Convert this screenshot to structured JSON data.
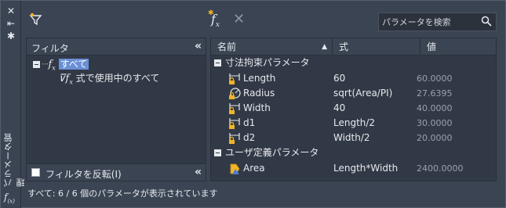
{
  "palette": {
    "vertical_title": "パラメータ管理",
    "side_fx": "f",
    "side_fx_sub": "(x)"
  },
  "toolbar": {
    "search_placeholder": "パラメータを検索",
    "fx_label": "f",
    "fx_sub": "x",
    "delete_label": "✕"
  },
  "filter": {
    "header": "フィルタ",
    "collapse": "«",
    "tree": {
      "root_fx": "f",
      "root_sub": "x",
      "root_label": "すべて",
      "child_fx": "f",
      "child_sub": "x",
      "child_label": "式で使用中のすべて"
    },
    "invert_label": "フィルタを反転(I)",
    "footer_collapse": "«"
  },
  "grid": {
    "columns": {
      "name": "名前",
      "expr": "式",
      "value": "値"
    },
    "sort_indicator": "▲",
    "groups": [
      {
        "label": "寸法拘束パラメータ",
        "rows": [
          {
            "icon": "linear-dimension-icon",
            "name": "Length",
            "expr": "60",
            "value": "60.0000"
          },
          {
            "icon": "radius-dimension-icon",
            "name": "Radius",
            "expr": "sqrt(Area/PI)",
            "value": "27.6395"
          },
          {
            "icon": "linear-dimension-icon",
            "name": "Width",
            "expr": "40",
            "value": "40.0000"
          },
          {
            "icon": "linear-dimension-icon",
            "name": "d1",
            "expr": "Length/2",
            "value": "30.0000"
          },
          {
            "icon": "linear-dimension-icon",
            "name": "d2",
            "expr": "Width/2",
            "value": "20.0000"
          }
        ]
      },
      {
        "label": "ユーザ定義パラメータ",
        "rows": [
          {
            "icon": "user-parameter-icon",
            "name": "Area",
            "expr": "Length*Width",
            "value": "2400.0000"
          }
        ]
      }
    ]
  },
  "status": "すべて: 6 / 6 個のパラメータが表示されています",
  "colors": {
    "background": "#3b4453",
    "panel": "#323946",
    "selection": "#6a8fd4",
    "lock": "#f0b429"
  }
}
